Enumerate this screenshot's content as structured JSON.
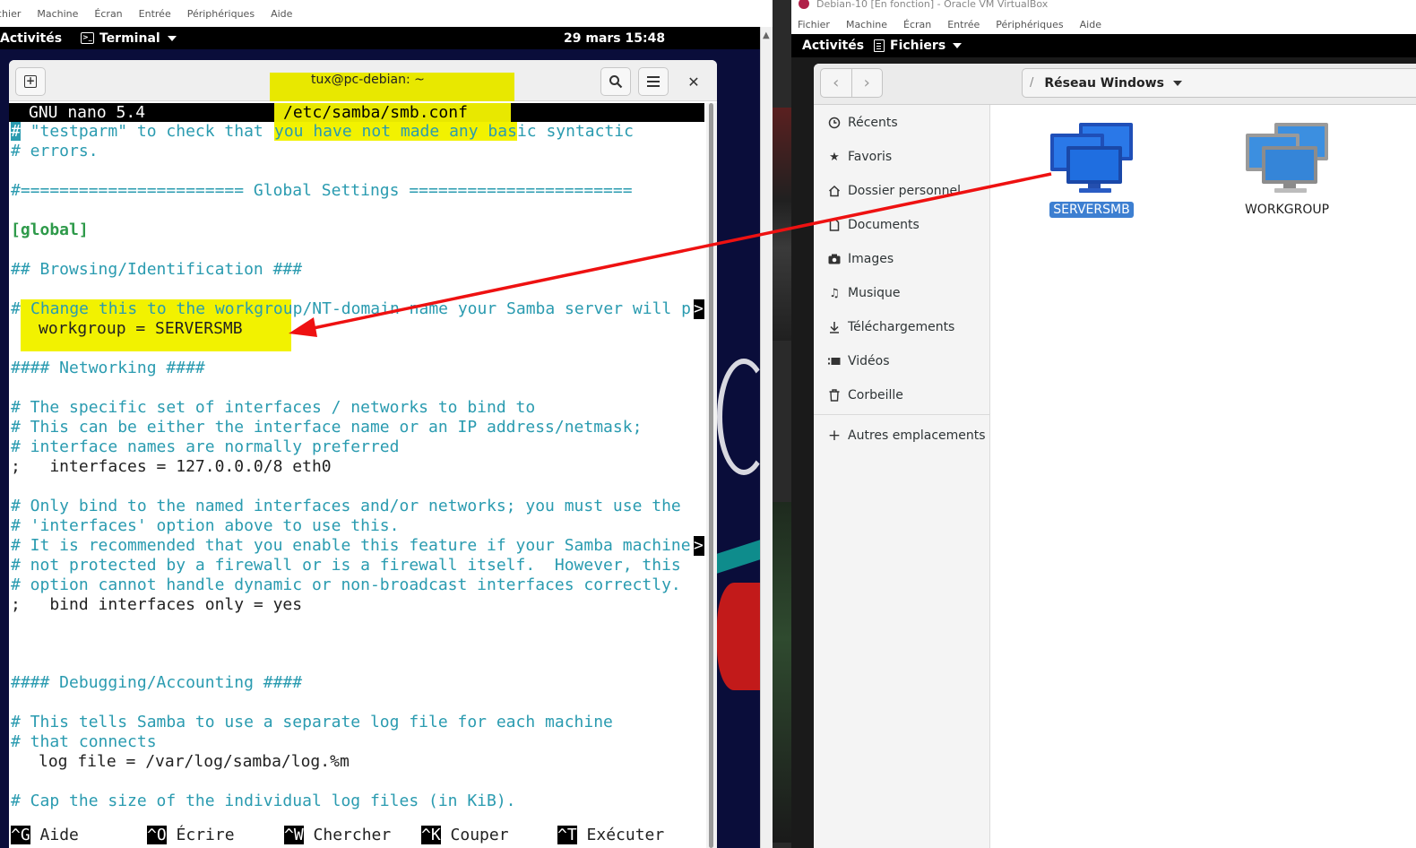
{
  "left_vm": {
    "menubar": [
      "Fichier",
      "Machine",
      "Écran",
      "Entrée",
      "Périphériques",
      "Aide"
    ],
    "menubar_visible": [
      "chier",
      "Machine",
      "Écran",
      "Entrée",
      "Périphériques",
      "Aide"
    ],
    "topbar": {
      "activities": "Activités",
      "app": "Terminal",
      "clock": "29 mars 15:48"
    },
    "terminal": {
      "title": "tux@pc-debian: ~",
      "nano_version": "GNU nano 5.4",
      "file_path": "/etc/samba/smb.conf",
      "lines": [
        {
          "a": "\"testparm\" to check that ",
          "b": "you have not made any bas",
          "c": "ic syntactic"
        },
        {
          "text": "# errors."
        },
        {
          "text": "#======================= Global Settings ======================="
        },
        {
          "text": "[global]"
        },
        {
          "text": "## Browsing/Identification ###"
        },
        {
          "a": "Change this to the workgrou",
          "b": "p/NT-domain name your Samba server will p"
        },
        {
          "text": "workgroup = SERVERSMB"
        },
        {
          "text": "#### Networking ####"
        },
        {
          "text": "# The specific set of interfaces / networks to bind to"
        },
        {
          "text": "# This can be either the interface name or an IP address/netmask;"
        },
        {
          "text": "# interface names are normally preferred"
        },
        {
          "text": ";   interfaces = 127.0.0.0/8 eth0"
        },
        {
          "text": "# Only bind to the named interfaces and/or networks; you must use the"
        },
        {
          "text": "# 'interfaces' option above to use this."
        },
        {
          "text": "# It is recommended that you enable this feature if your Samba machine"
        },
        {
          "text": "# not protected by a firewall or is a firewall itself.  However, this"
        },
        {
          "text": "# option cannot handle dynamic or non-broadcast interfaces correctly."
        },
        {
          "text": ";   bind interfaces only = yes"
        },
        {
          "text": "#### Debugging/Accounting ####"
        },
        {
          "text": "# This tells Samba to use a separate log file for each machine"
        },
        {
          "text": "# that connects"
        },
        {
          "text": "log file = /var/log/samba/log.%m"
        },
        {
          "text": "# Cap the size of the individual log files (in KiB)."
        }
      ],
      "shortcuts": [
        {
          "key": "^G",
          "label": "Aide"
        },
        {
          "key": "^O",
          "label": "Écrire"
        },
        {
          "key": "^W",
          "label": "Chercher"
        },
        {
          "key": "^K",
          "label": "Couper"
        },
        {
          "key": "^T",
          "label": "Exécuter"
        }
      ]
    }
  },
  "right_vm": {
    "window_title": "Debian-10 [En fonction] - Oracle VM VirtualBox",
    "menubar": [
      "Fichier",
      "Machine",
      "Écran",
      "Entrée",
      "Périphériques",
      "Aide"
    ],
    "topbar": {
      "activities": "Activités",
      "app": "Fichiers"
    },
    "files": {
      "path_separator": "/",
      "location": "Réseau Windows",
      "sidebar": [
        {
          "label": "Récents",
          "icon": "clock-icon"
        },
        {
          "label": "Favoris",
          "icon": "star-icon"
        },
        {
          "label": "Dossier personnel",
          "icon": "home-icon"
        },
        {
          "label": "Documents",
          "icon": "document-icon"
        },
        {
          "label": "Images",
          "icon": "camera-icon"
        },
        {
          "label": "Musique",
          "icon": "music-icon"
        },
        {
          "label": "Téléchargements",
          "icon": "download-icon"
        },
        {
          "label": "Vidéos",
          "icon": "video-icon"
        },
        {
          "label": "Corbeille",
          "icon": "trash-icon"
        }
      ],
      "other_locations": "Autres emplacements",
      "network_items": [
        {
          "label": "SERVERSMB",
          "selected": true
        },
        {
          "label": "WORKGROUP",
          "selected": false
        }
      ]
    }
  },
  "colors": {
    "highlight": "#f2f200",
    "comment": "#2a9bb0",
    "arrow": "#ee1111",
    "selection": "#3d7fd1",
    "desktop": "#0a0d3a"
  }
}
